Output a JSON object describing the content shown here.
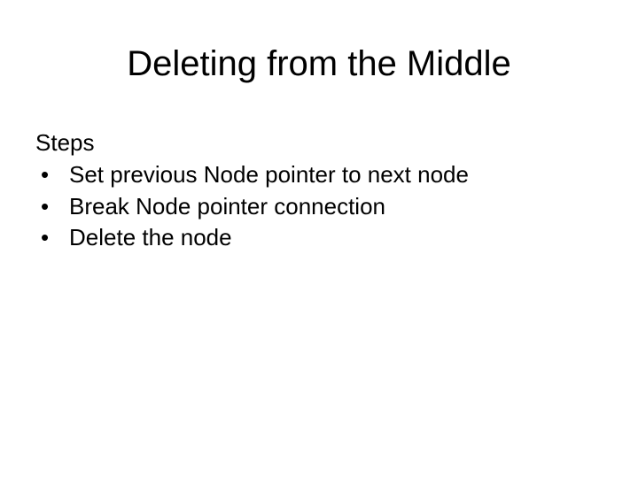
{
  "slide": {
    "title": "Deleting from the Middle",
    "subtitle": "Steps",
    "bullets": {
      "0": "Set previous Node pointer to next node",
      "1": "Break Node pointer connection",
      "2": "Delete the node"
    }
  }
}
